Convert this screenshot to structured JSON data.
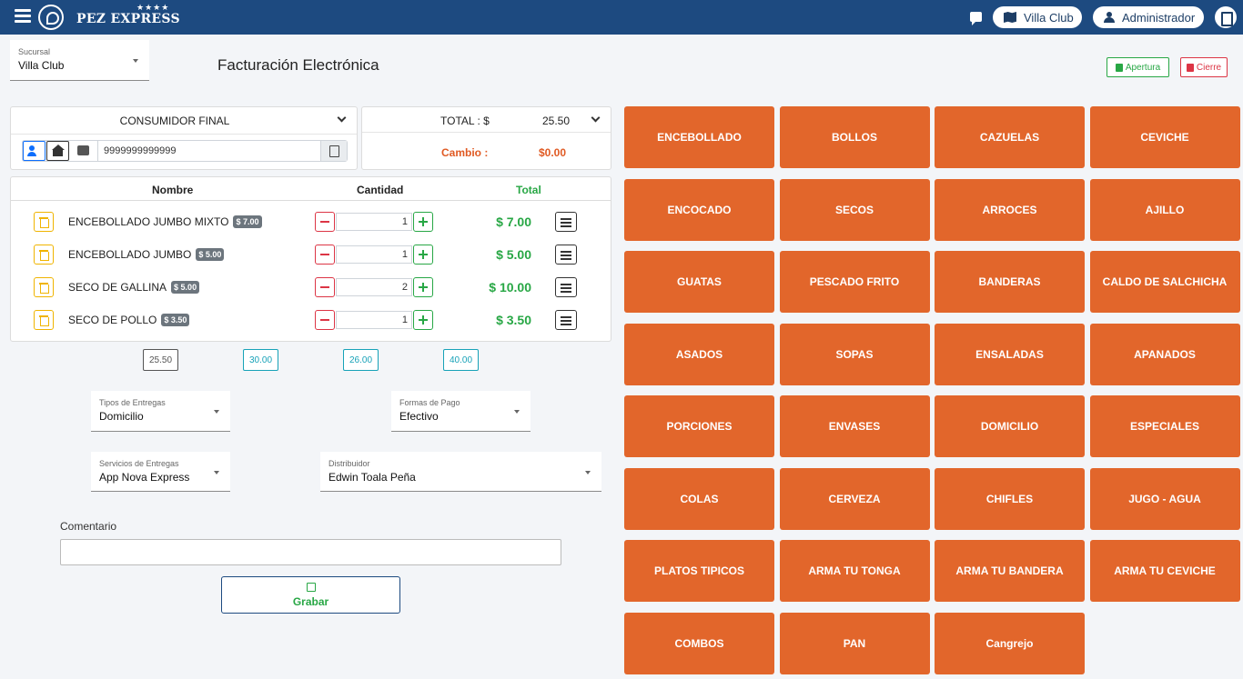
{
  "header": {
    "brand": "PEZ EXPRESS",
    "brand_stars": "★★★★",
    "branch_button": "Villa Club",
    "user_button": "Administrador"
  },
  "branch_select": {
    "label": "Sucursal",
    "value": "Villa Club"
  },
  "page_title": "Facturación Electrónica",
  "actions": {
    "open_label": "Apertura",
    "close_label": "Cierre"
  },
  "customer": {
    "title": "CONSUMIDOR FINAL",
    "id_number": "9999999999999"
  },
  "totals": {
    "total_label": "TOTAL : $",
    "total_value": "25.50",
    "change_label": "Cambio :",
    "change_value": "$0.00"
  },
  "table": {
    "headers": {
      "name": "Nombre",
      "quantity": "Cantidad",
      "total": "Total"
    },
    "items": [
      {
        "name": "ENCEBOLLADO JUMBO MIXTO",
        "price": "$ 7.00",
        "qty": "1",
        "total": "$ 7.00"
      },
      {
        "name": "ENCEBOLLADO JUMBO",
        "price": "$ 5.00",
        "qty": "1",
        "total": "$ 5.00"
      },
      {
        "name": "SECO DE GALLINA",
        "price": "$ 5.00",
        "qty": "2",
        "total": "$ 10.00"
      },
      {
        "name": "SECO DE POLLO",
        "price": "$ 3.50",
        "qty": "1",
        "total": "$ 3.50"
      }
    ]
  },
  "quick_amounts": [
    "25.50",
    "30.00",
    "26.00",
    "40.00"
  ],
  "delivery": {
    "type_label": "Tipos de Entregas",
    "type_value": "Domicilio",
    "payment_label": "Formas de Pago",
    "payment_value": "Efectivo",
    "service_label": "Servicios de Entregas",
    "service_value": "App Nova Express",
    "distributor_label": "Distribuidor",
    "distributor_value": "Edwin Toala Peña"
  },
  "comment": {
    "label": "Comentario",
    "value": ""
  },
  "save_label": "Grabar",
  "categories": [
    "ENCEBOLLADO",
    "BOLLOS",
    "CAZUELAS",
    "CEVICHE",
    "ENCOCADO",
    "SECOS",
    "ARROCES",
    "AJILLO",
    "GUATAS",
    "PESCADO FRITO",
    "BANDERAS",
    "CALDO DE SALCHICHA",
    "ASADOS",
    "SOPAS",
    "ENSALADAS",
    "APANADOS",
    "PORCIONES",
    "ENVASES",
    "DOMICILIO",
    "ESPECIALES",
    "COLAS",
    "CERVEZA",
    "CHIFLES",
    "JUGO - AGUA",
    "PLATOS TIPICOS",
    "ARMA TU TONGA",
    "ARMA TU BANDERA",
    "ARMA TU CEVICHE",
    "COMBOS",
    "PAN",
    "Cangrejo"
  ],
  "colors": {
    "header": "#1d4a80",
    "tile": "#e2662b",
    "success": "#28a745",
    "danger": "#dc3545",
    "warning": "#f0b400"
  }
}
